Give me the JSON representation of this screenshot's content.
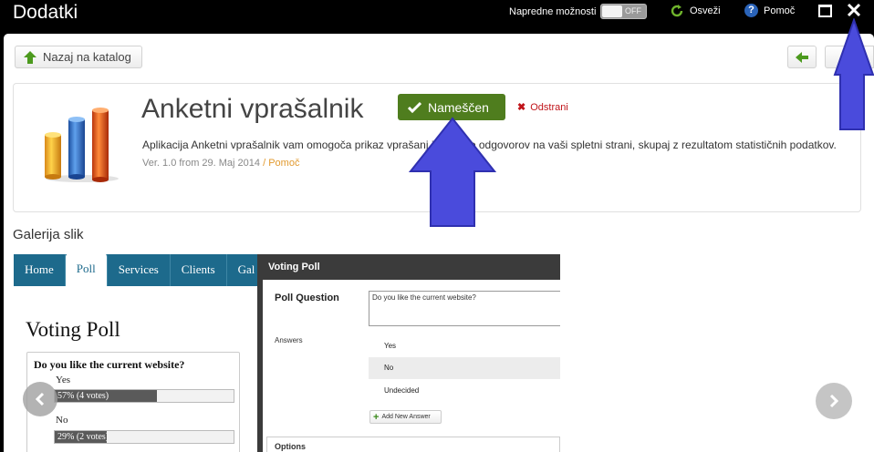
{
  "window": {
    "title": "Dodatki",
    "advanced_label": "Napredne možnosti",
    "toggle_state": "OFF",
    "refresh_label": "Osveži",
    "help_label": "Pomoč",
    "help_icon_glyph": "?"
  },
  "toolbar": {
    "back_label": "Nazaj na katalog"
  },
  "app": {
    "name": "Anketni vprašalnik",
    "installed_label": "Nameščen",
    "remove_label": "Odstrani",
    "remove_glyph": "✖",
    "description": "Aplikacija Anketni vprašalnik vam omogoča prikaz vprašanj in možno odgovorov na vaši spletni strani, skupaj z rezultatom statističnih podatkov.",
    "version": "Ver. 1.0 from 29. Maj 2014",
    "meta_separator": " / ",
    "help_link": "Pomoč",
    "accent_color": "#4f7d1e",
    "remove_color": "#c0141a"
  },
  "gallery": {
    "title": "Galerija slik",
    "shot1": {
      "tabs": [
        "Home",
        "Poll",
        "Services",
        "Clients",
        "Gal"
      ],
      "active_tab": "Poll",
      "heading": "Voting Poll",
      "question": "Do you like the current website?",
      "options": [
        {
          "label": "Yes",
          "bar_text": "57% (4 votes)",
          "percent": 57
        },
        {
          "label": "No",
          "bar_text": "29% (2 votes)",
          "percent": 29
        }
      ]
    },
    "shot2": {
      "title": "Voting Poll",
      "poll_question_label": "Poll Question",
      "poll_question_value": "Do you like the current website?",
      "answers_label": "Answers",
      "answers": [
        "Yes",
        "No",
        "Undecided"
      ],
      "add_answer_label": "Add New Answer",
      "add_glyph": "+",
      "options_label": "Options"
    }
  }
}
